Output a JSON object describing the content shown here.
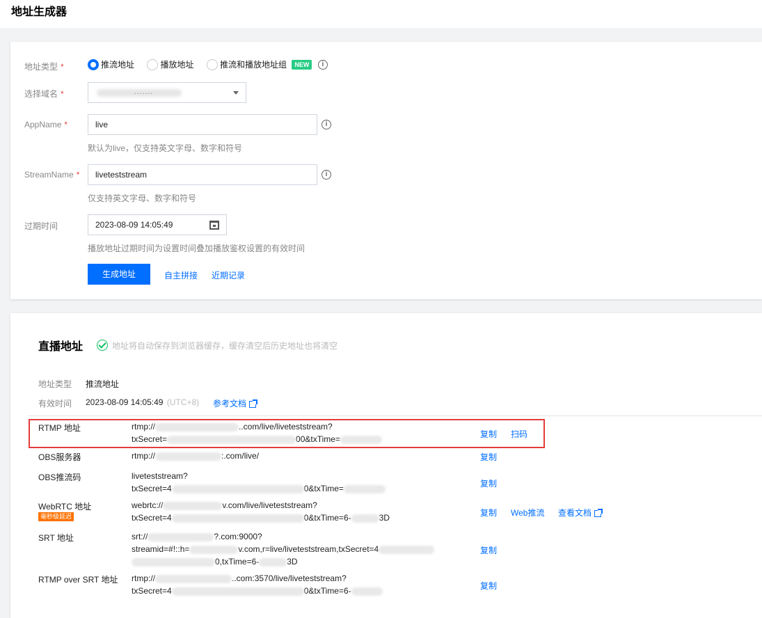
{
  "page": {
    "title": "地址生成器"
  },
  "form": {
    "address_type": {
      "label": "地址类型",
      "required_mark": "*",
      "options": [
        "推流地址",
        "播放地址",
        "推流和播放地址组"
      ],
      "selected": "推流地址",
      "new_badge": "NEW"
    },
    "domain": {
      "label": "选择域名",
      "required_mark": "*",
      "value_masked": "……."
    },
    "app_name": {
      "label": "AppName",
      "required_mark": "*",
      "value": "live",
      "hint": "默认为live，仅支持英文字母、数字和符号"
    },
    "stream_name": {
      "label": "StreamName",
      "required_mark": "*",
      "value": "liveteststream",
      "hint": "仅支持英文字母、数字和符号"
    },
    "expire": {
      "label": "过期时间",
      "value": "2023-08-09 14:05:49",
      "hint": "播放地址过期时间为设置时间叠加播放鉴权设置的有效时间"
    },
    "generate_button": "生成地址",
    "custom_link": "自主拼接",
    "recent_link": "近期记录"
  },
  "result": {
    "title": "直播地址",
    "notice": "地址将自动保存到浏览器缓存，缓存清空后历史地址也将清空",
    "type_label": "地址类型",
    "type_value": "推流地址",
    "valid_label": "有效时间",
    "valid_value": "2023-08-09 14:05:49",
    "valid_tz": "(UTC+8)",
    "doc_link": "参考文档",
    "rows": [
      {
        "label": "RTMP 地址",
        "line1_pre": "rtmp://",
        "line1_post": "..com/live/liveteststream?",
        "line2_pre": "txSecret=",
        "line2_post": "00&txTime=",
        "actions": [
          "复制",
          "扫码"
        ]
      },
      {
        "label": "OBS服务器",
        "line1_pre": "rtmp://",
        "line1_post": ":.com/live/",
        "actions": [
          "复制"
        ]
      },
      {
        "label": "OBS推流码",
        "line1_pre": "liveteststream?",
        "line1_post": "",
        "line2_pre": "txSecret=4",
        "line2_post": "0&txTime=",
        "actions": [
          "复制"
        ]
      },
      {
        "label": "WebRTC 地址",
        "badge": "毫秒级延迟",
        "line1_pre": "webrtc://",
        "line1_post": "v.com/live/liveteststream?",
        "line2_pre": "txSecret=4",
        "line2_post": "0&txTime=6-",
        "line2_tail": "3D",
        "actions": [
          "复制",
          "Web推流",
          "查看文档"
        ]
      },
      {
        "label": "SRT 地址",
        "line1_pre": "srt://",
        "line1_post": "?.com:9000?",
        "line2_pre": "streamid=#!::h=",
        "line2_post": "v.com,r=live/liveteststream,txSecret=4",
        "line3_pre": "",
        "line3_post": "0,txTime=6-",
        "line3_tail": "3D",
        "actions": [
          "复制"
        ]
      },
      {
        "label": "RTMP over SRT 地址",
        "line1_pre": "rtmp://",
        "line1_post": "..com:3570/live/liveteststream?",
        "line2_pre": "txSecret=4",
        "line2_post": "0&txTime=6-",
        "actions": [
          "复制"
        ]
      }
    ]
  }
}
